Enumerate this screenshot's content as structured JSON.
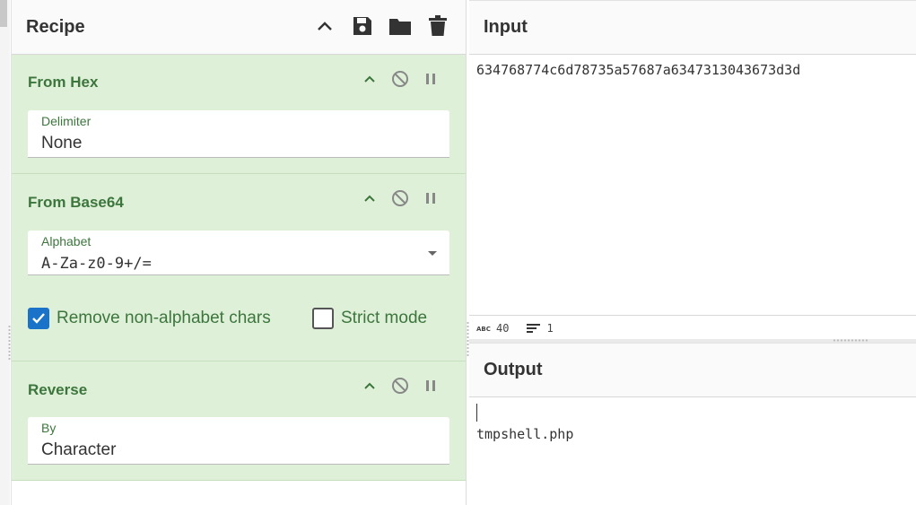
{
  "recipe": {
    "title": "Recipe",
    "header_icons": [
      "chevron-up-icon",
      "save-icon",
      "folder-icon",
      "trash-icon"
    ],
    "operations": [
      {
        "title": "From Hex",
        "fields": [
          {
            "label": "Delimiter",
            "value": "None"
          }
        ]
      },
      {
        "title": "From Base64",
        "fields": [
          {
            "label": "Alphabet",
            "value": "A-Za-z0-9+/="
          }
        ],
        "checkboxes": [
          {
            "label": "Remove non-alphabet chars",
            "checked": true
          },
          {
            "label": "Strict mode",
            "checked": false
          }
        ]
      },
      {
        "title": "Reverse",
        "fields": [
          {
            "label": "By",
            "value": "Character"
          }
        ]
      }
    ]
  },
  "input": {
    "title": "Input",
    "text": "634768774c6d78735a57687a6347313043673d3d",
    "status": {
      "length_icon": "abc-icon",
      "length": "40",
      "lines_icon": "lines-icon",
      "lines": "1"
    }
  },
  "output": {
    "title": "Output",
    "text": "tmpshell.php"
  },
  "colors": {
    "op_background": "#dff0d8",
    "op_text": "#3c763d",
    "checkbox_checked": "#1a73c9"
  }
}
